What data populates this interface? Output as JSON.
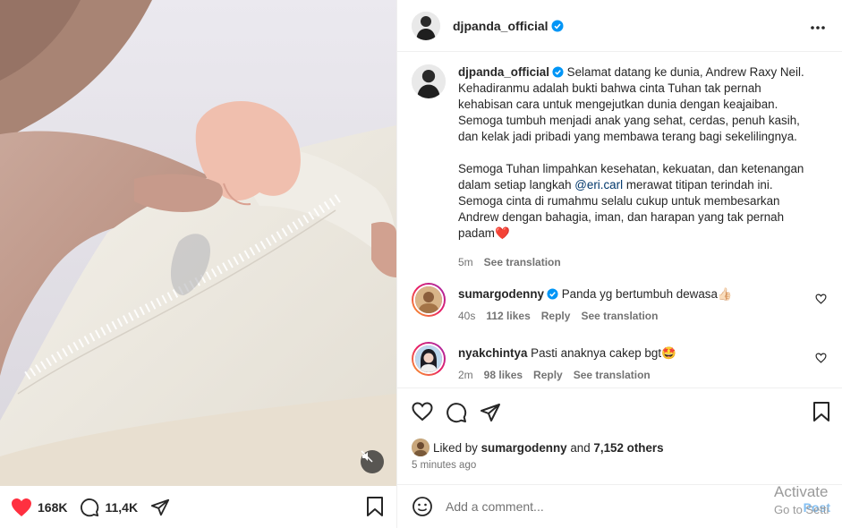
{
  "post": {
    "username": "djpanda_official",
    "caption_p1": "Selamat datang ke dunia, Andrew Raxy Neil. Kehadiranmu adalah bukti bahwa cinta Tuhan tak pernah kehabisan cara untuk mengejutkan dunia dengan keajaiban. Semoga tumbuh menjadi anak yang sehat, cerdas, penuh kasih, dan kelak jadi pribadi yang membawa terang bagi sekelilingnya.",
    "caption_p2_a": "Semoga Tuhan limpahkan kesehatan, kekuatan, dan ketenangan dalam setiap langkah",
    "caption_mention": "@eri.carl",
    "caption_p2_b": "merawat titipan terindah ini. Semoga cinta di rumahmu selalu cukup untuk membesarkan Andrew dengan bahagia, iman, dan harapan yang tak pernah padam",
    "caption_emoji": "❤️",
    "caption_time": "5m",
    "see_translation": "See translation",
    "more_icon": "more-options-icon"
  },
  "comments": [
    {
      "username": "sumargodenny",
      "text": "Panda yg bertumbuh dewasa👍🏻",
      "time": "40s",
      "likes": "112 likes",
      "reply": "Reply",
      "translation": "See translation"
    },
    {
      "username": "nyakchintya",
      "text": "Pasti anaknya cakep bgt🤩",
      "time": "2m",
      "likes": "98 likes",
      "reply": "Reply",
      "translation": "See translation"
    }
  ],
  "actions": {
    "liked_by_prefix": "Liked by",
    "liked_by_user": "sumargodenny",
    "liked_by_and": "and",
    "liked_by_others": "7,152 others",
    "time_ago": "5 minutes ago"
  },
  "add_comment": {
    "placeholder": "Add a comment...",
    "post_label": "Post"
  },
  "left_bar": {
    "likes": "168K",
    "comments": "11,4K"
  },
  "watermark": {
    "line1": "Activate",
    "line2": "Go to Setti"
  },
  "colors": {
    "heart_red": "#ff3040",
    "verified_blue": "#0095f6",
    "post_blue": "#85c1f4"
  }
}
